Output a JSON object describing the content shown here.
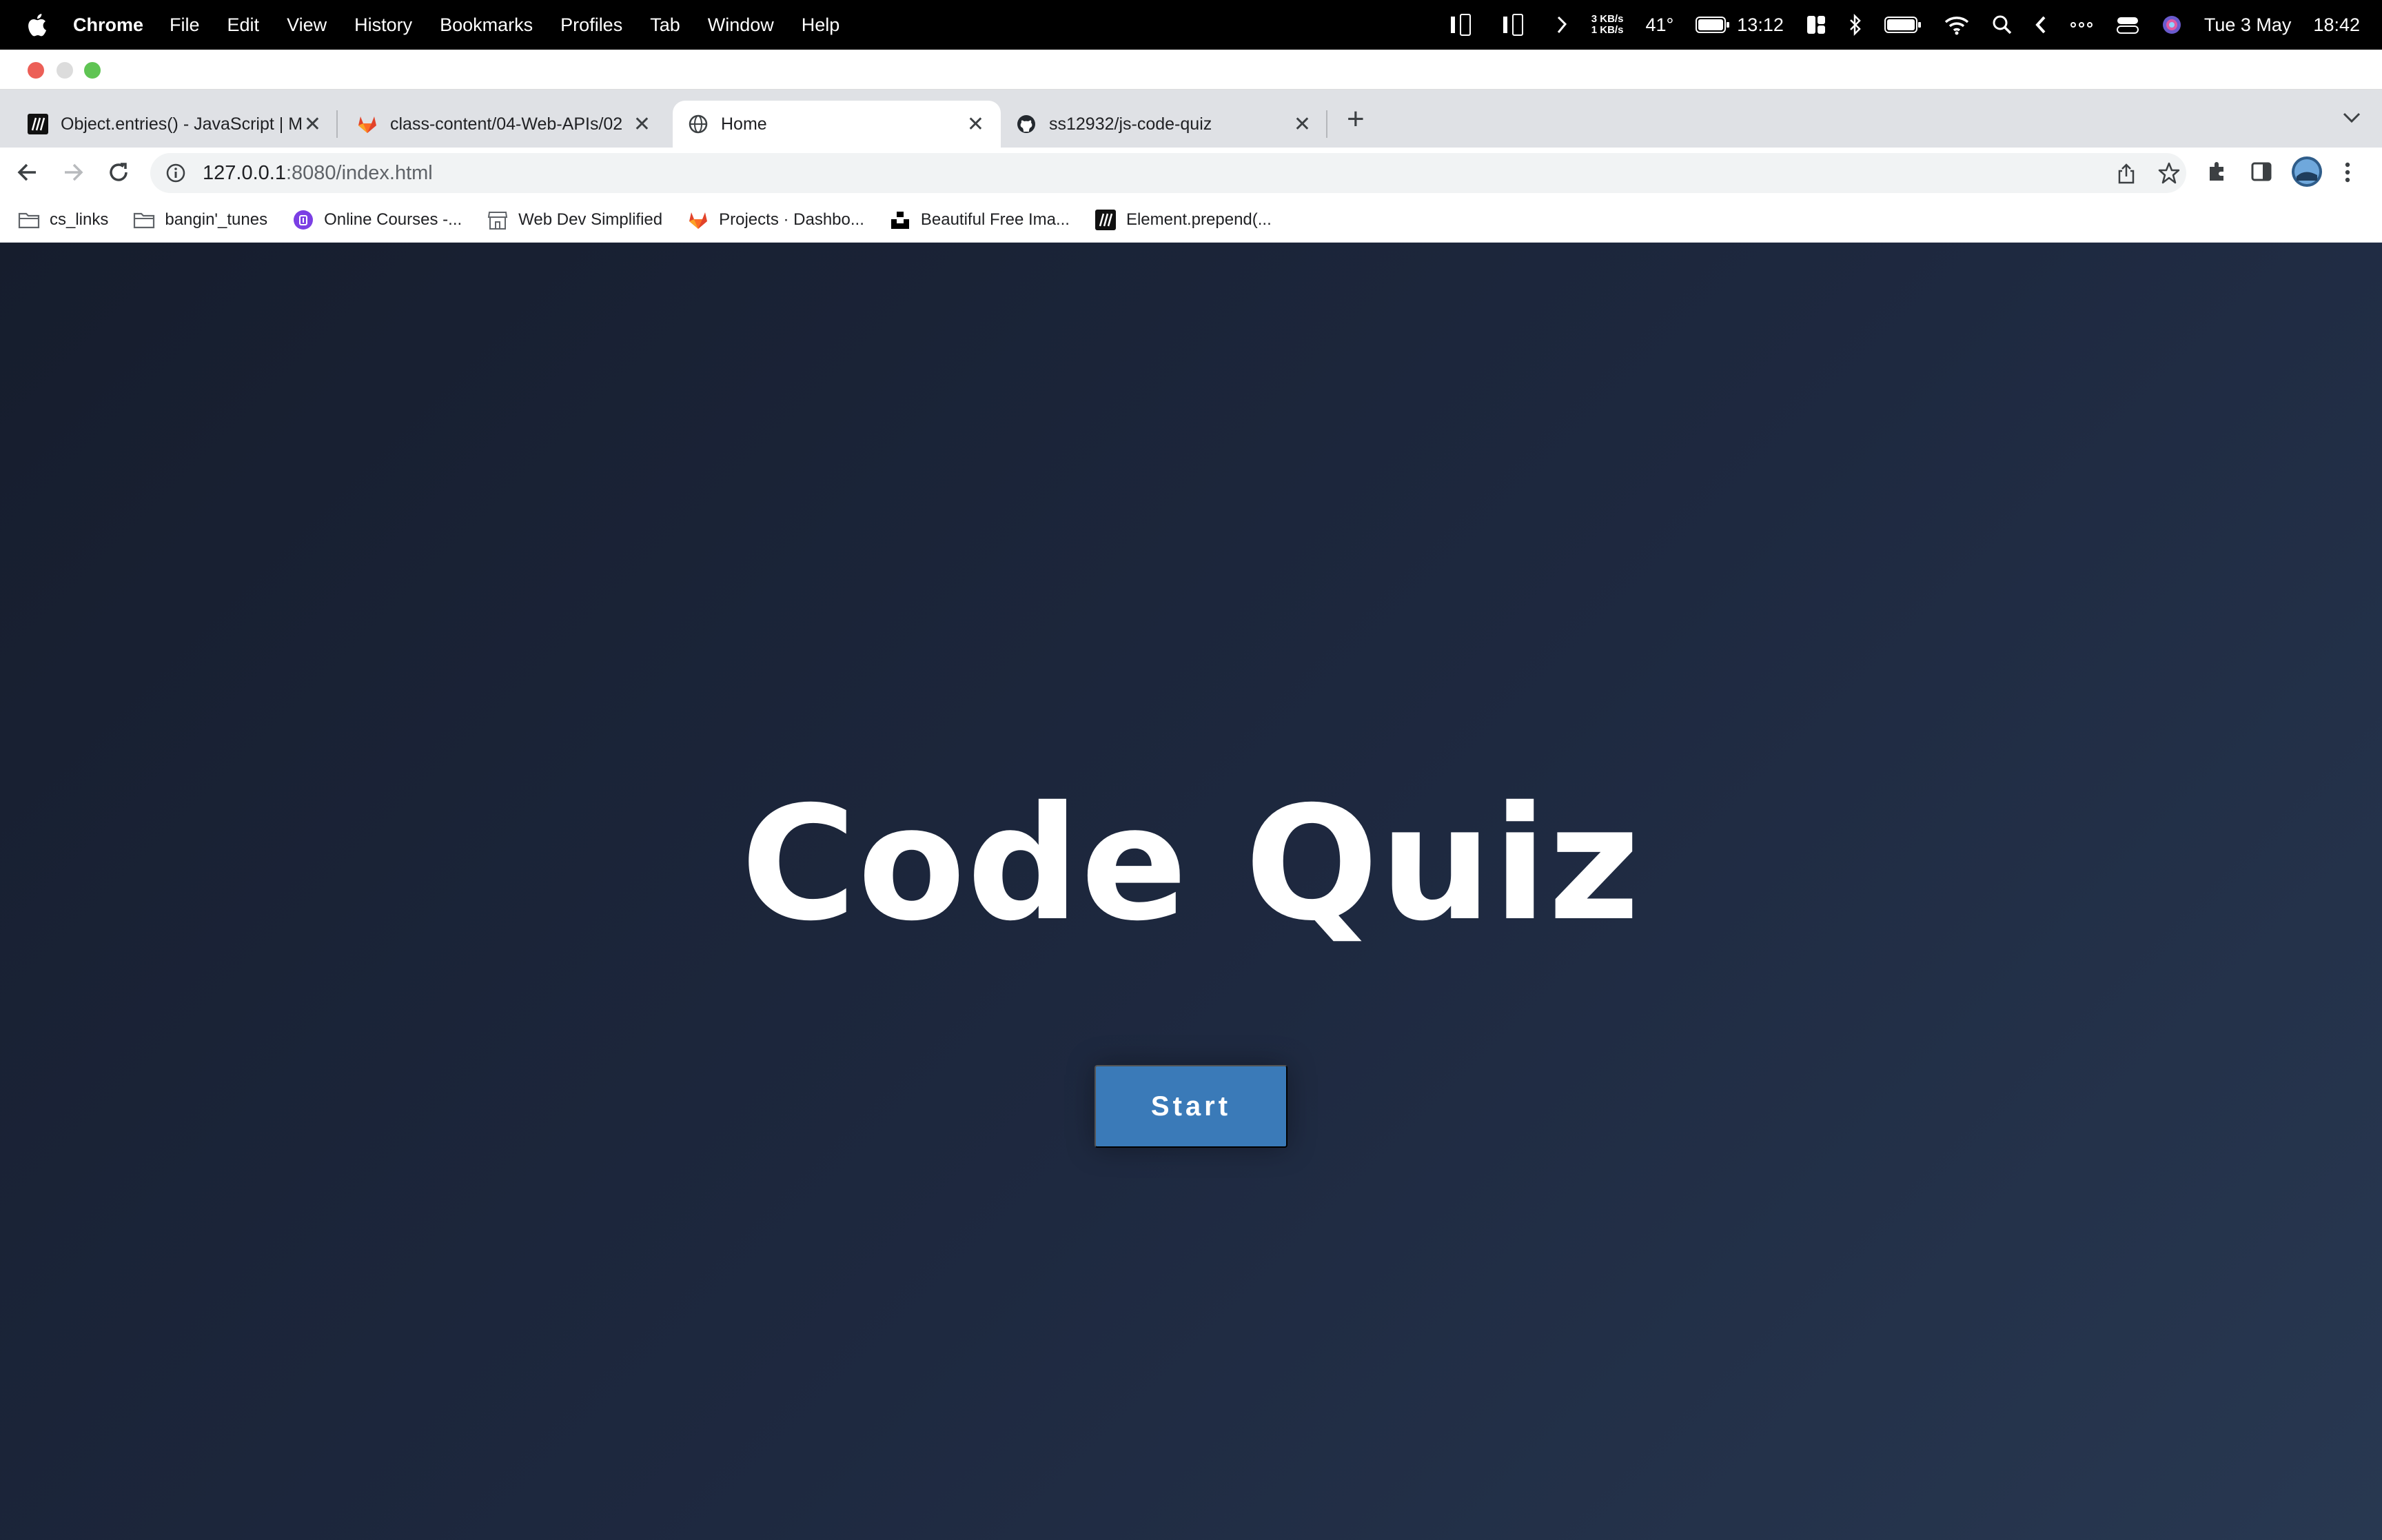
{
  "menubar": {
    "app_name": "Chrome",
    "menus": [
      "File",
      "Edit",
      "View",
      "History",
      "Bookmarks",
      "Profiles",
      "Tab",
      "Window",
      "Help"
    ],
    "status": {
      "net_up": "3 KB/s",
      "net_down": "1 KB/s",
      "temperature": "41°",
      "battery_time": "13:12",
      "date": "Tue 3 May",
      "time": "18:42"
    }
  },
  "tabs": [
    {
      "label": "Object.entries() - JavaScript | M",
      "icon": "mdn-icon",
      "active": false
    },
    {
      "label": "class-content/04-Web-APIs/02",
      "icon": "gitlab-icon",
      "active": false
    },
    {
      "label": "Home",
      "icon": "globe-icon",
      "active": true
    },
    {
      "label": "ss12932/js-code-quiz",
      "icon": "github-icon",
      "active": false
    }
  ],
  "address_bar": {
    "host": "127.0.0.1",
    "path": ":8080/index.html"
  },
  "bookmarks": [
    {
      "label": "cs_links",
      "icon": "folder-icon"
    },
    {
      "label": "bangin'_tunes",
      "icon": "folder-icon"
    },
    {
      "label": "Online Courses -...",
      "icon": "course-icon"
    },
    {
      "label": "Web Dev Simplified",
      "icon": "store-icon"
    },
    {
      "label": "Projects · Dashbo...",
      "icon": "gitlab-icon"
    },
    {
      "label": "Beautiful Free Ima...",
      "icon": "unsplash-icon"
    },
    {
      "label": "Element.prepend(...",
      "icon": "mdn-icon"
    }
  ],
  "page": {
    "title": "Code Quiz",
    "start_button": "Start"
  },
  "colors": {
    "page_bg": "#1b2336",
    "start_button": "#3a7ab8",
    "title_text": "#ffffff"
  }
}
